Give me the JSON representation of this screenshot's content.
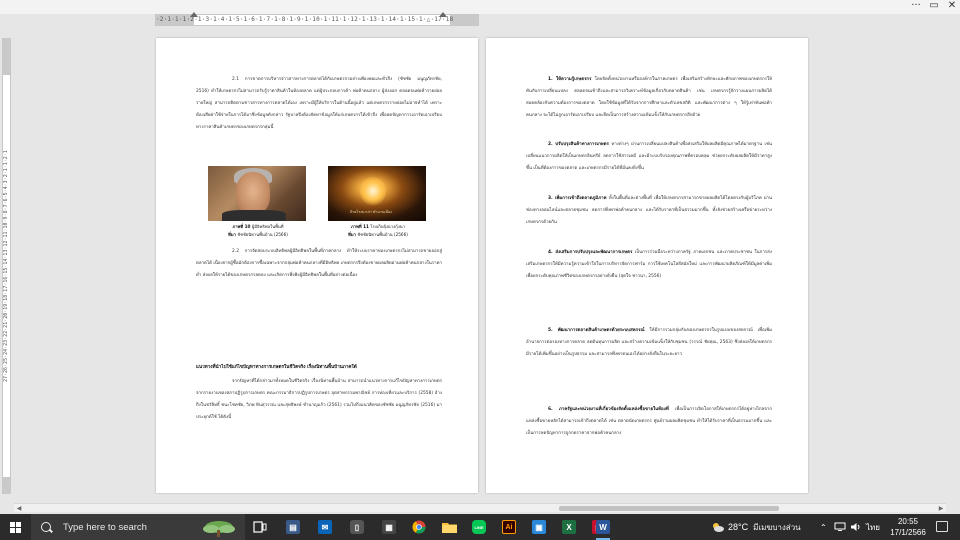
{
  "window": {
    "more_label": "···",
    "restore_label": "▭",
    "close_label": "✕"
  },
  "ruler": {
    "horizontal_ticks": "·2·1·1·1·2·1·3·1·4·1·5·1·6·1·7·1·8·1·9·1·10·1·11·1·12·1·13·1·14·1·15·1·△·17·18",
    "vertical_ticks": "27·26·25·24·23·22·21·20·19·18·17·16·15·14·13·12·11·10·9·8·7·6·5·4·3·2·1·1·2·1"
  },
  "left_page": {
    "para1": "2.1 การขาดการบริหารจ่าวสารทางการตลาดได้กับเกษตรกรอย่างเพียงพอและทั่วถึง (ชัชชัย มนูญภัทรชัย, 2516) ทำให้เกษตรกรไม่สามารถรับรู้ราคาสินค้าในท้องตลาด แต่ผู้ประกอบการค้า พ่อค้าคนกลาง ผู้ส่งออก ตลอดจนพ่อค้ารายย่อยรายใหญ่ สามารถติดตามข่าวสารทางการตลาดได้เอง เพราะมีผู้ให้บริการในด้านนี้อยู่แล้ว แต่เกษตรกรรายย่อยไม่อาจทำได้ เพราะต้องเสียค่าใช้จ่ายในการได้มาซึ่งข้อมูลดังกล่าว รัฐบาลจึงต้องจัดหาข้อมูลให้แก่เกษตรกรได้เข้าถึง เพื่อลดปัญหาการเอารัดเอาเปรียบทางราคาสินค้าเกษตรของเกษตรกรกลุ่มนี้",
    "fig1_title": "ภาพที่ 10",
    "fig1_desc": "ผู้มีอิทธิพลในพื้นที่",
    "fig1_credit_label": "ที่มา",
    "fig1_credit": "ชัชชัยนิทานพื้นบ้าน (2566)",
    "fig2_title": "ภาพที่ 11",
    "fig2_desc": "โรงเก็บยุ้งฉางกุ้งนา",
    "fig2_credit_label": "ที่มา",
    "fig2_credit": "ชัชชัยนิทานพื้นบ้าน (2566)",
    "fig2_overlay": "ป้ายโรงนาเก่า ตำนานเมือง",
    "para2": "2.2 การจัดสอบระบบอิทธิพลผู้มีอิทธิพลในพื้นที่ภาคกลาง ทำให้ระบบราคาของเกษตรกรไม่สามารถขายออกสู่ตลาดได้ เนื่องจากผู้ซื้อมักต้องการซื้อเฉพาะจากกลุ่มพ่อค้าคนกลางที่มีอิทธิพล เกษตรกรจึงต้องขายผลผลิตผ่านพ่อค้าคนกลางในราคาต่ำ ส่งผลให้รายได้ของเกษตรกรลดลง และเกิดการพึ่งพิงผู้มีอิทธิพลในพื้นที่อย่างต่อเนื่อง",
    "heading": "แนวทางที่นำไปใช้แก้ไขปัญหาทางการเกษตรในชีวิตจริง เรื่องนิทานพื้นบ้านภาคใต้",
    "para3": "จากปัญหาที่ได้กล่าวมาทั้งหมดในชีวิตจริง เรื่องนิทานพื้นบ้าน สามารถนำแนวทางการแก้ไขปัญหาทางการเกษตรจากรายงานของสภาปฏิรูปการเกษตร คณะกรรมาธิการปฏิรูปการเกษตร อุตสาหกรรมพาณิชย์ การท่องเที่ยวและบริการ (2558) อ้างถึงในชวัลิทธิ์ ชนะโชคชัย, วิภพ ทินสุวรรณ และสุทธิพงษ์ ชำนาญแก้ว (2561) รวมไปถึงแนวคิดของชัชชัย มนูญภัทรชัย (2516) มาประยุกต์ใช้ ได้ดังนี้"
  },
  "right_page": {
    "p1_title": "1. ให้ความรู้เกษตรกร",
    "p1_body": "โดยจัดตั้งหน่วยงานหรือองค์กรในภาคเกษตร เพื่อเสริมสร้างทักษะและศักยภาพของเกษตรกรให้ทันกับการเปลี่ยนแปลง ตลอดจนเข้าถึงและสามารถวิเคราะห์ข้อมูลเกี่ยวกับตลาดสินค้า เช่น เกษตรกรรู้จักวางแผนการผลิตได้สอดคล้องกับความต้องการของตลาด โดยใช้ข้อมูลที่ได้รับจากการศึกษาและตัวเลขสถิติ และพัฒนาการต่าง ๆ ให้รู้เท่าทันพ่อค้าคนกลาง จะได้ไม่ถูกเอารัดเอาเปรียบ และยึดเป็นการสร้างความเข้มแข็งให้กับเกษตรกรอีกด้วย",
    "p2_title": "2. ปรับปรุงสินค้าทางการเกษตร",
    "p2_body": "ทางต่างๆ ผ่านการเปลี่ยนแปลงสินค้าเพื่อส่งเสริมให้ผลผลิตมีคุณภาพได้มาตรฐาน เช่น เปลี่ยนแนวการผลิตให้เป็นเกษตรอินทรีย์ ลดการใช้สารเคมี และมีระบบรับรองคุณภาพที่ครอบคลุม ช่วยยกระดับผลผลิตให้มีราคาสูงขึ้น เป็นที่ต้องการของตลาด และเกษตรกรมีรายได้ที่มั่นคงยิ่งขึ้น",
    "p3_title": "3. เพิ่มการเข้าถึงตลาดภูมิภาค",
    "p3_body": "ทั้งในพื้นที่และต่างพื้นที่ เพื่อให้เกษตรกรสามารถขายผลผลิตได้โดยตรงกับผู้บริโภค ผ่านช่องทางออนไลน์และตลาดชุมชน ลดการพึ่งพาพ่อค้าคนกลาง และได้รับราคาที่เป็นธรรมมากขึ้น ทั้งยังช่วยสร้างเครือข่ายระหว่างเกษตรกรด้วยกัน",
    "p4_title": "4. ส่งเสริมการปรับปรุงและพัฒนาการเกษตร",
    "p4_body": "เป็นการร่วมมือระหว่างภาครัฐ ภาคเอกชน และภาคประชาชน ในการส่งเสริมเกษตรกรให้มีความรู้ความเข้าใจในการบริหารจัดการฟาร์ม การใช้เทคโนโลยีสมัยใหม่ และการพัฒนาผลิตภัณฑ์ให้มีมูลค่าเพิ่ม เพื่อยกระดับคุณภาพชีวิตของเกษตรกรอย่างยั่งยืน (สุดใจ ชาวนา, 2556)",
    "p5_title": "5. พัฒนาการตลาดสินค้าเกษตรด้วยระบบสหกรณ์",
    "p5_body": "ให้มีการรวมกลุ่มกันของเกษตรกรในรูปแบบของสหกรณ์ เพื่อเพิ่มอำนาจการต่อรองทางการตลาด ลดต้นทุนการผลิต และสร้างความเข้มแข็งให้กับชุมชน (วรรณ์ ชัยคุณ, 2563) ซึ่งส่งผลให้เกษตรกรมีรายได้เพิ่มขึ้นอย่างเป็นรูปธรรม และสามารถพึ่งพาตนเองได้อย่างยั่งยืนในระยะยาว",
    "p6_title": "6. ภาครัฐและหน่วยงานที่เกี่ยวข้องจัดตั้งแหล่งซื้อขายในท้องที่",
    "p6_body": "เพื่อเป็นการเปิดโอกาสให้เกษตรกรได้อยู่ห่างไกลจากแหล่งซื้อขายหลักได้สามารถเข้าถึงตลาดได้ เช่น ตลาดนัดเกษตรกร ศูนย์รวมผลผลิตชุมชน ทำให้ได้รับราคาที่เป็นธรรมมากขึ้น และเป็นการลดปัญหาการถูกกดราคาจากพ่อค้าคนกลาง"
  },
  "taskbar": {
    "search_placeholder": "Type here to search",
    "weather_temp": "28°C",
    "weather_desc": "มีเมฆบางส่วน",
    "lang": "ไทย",
    "time": "20:55",
    "date": "17/1/2566",
    "icon_word_letter": "W",
    "icon_excel_letter": "X",
    "icon_ai_letter": "Ai",
    "icon_line_letter": "LINE"
  }
}
